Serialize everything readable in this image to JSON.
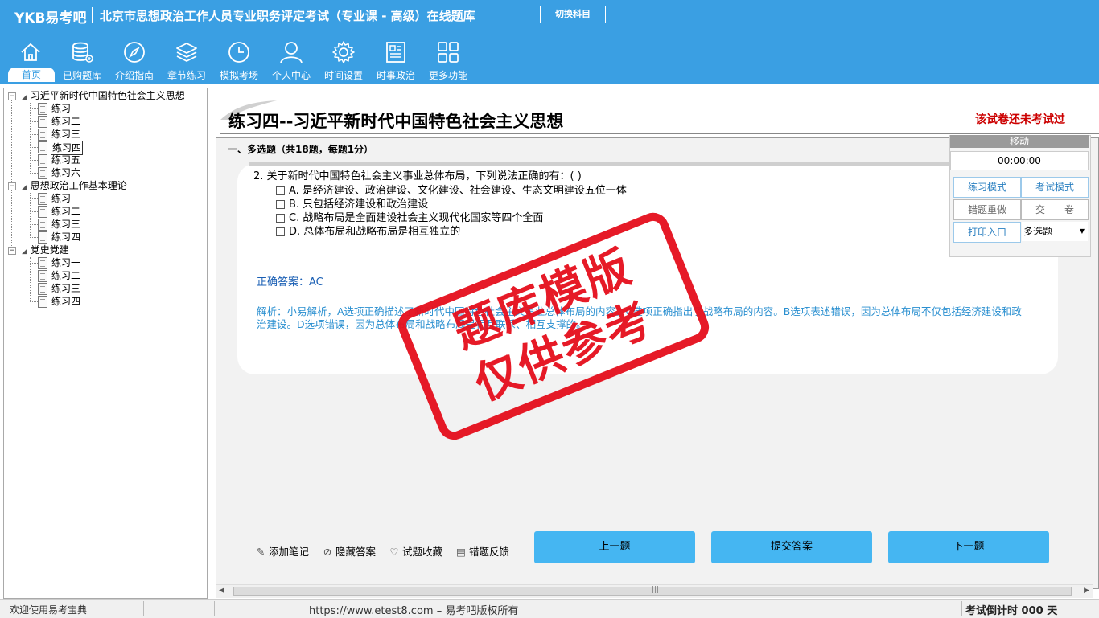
{
  "header": {
    "logo": "YKB易考吧",
    "title": "北京市思想政治工作人员专业职务评定考试（专业课 - 高级）在线题库",
    "switch_button": "切换科目"
  },
  "nav": [
    {
      "label": "首页",
      "icon": "home-icon"
    },
    {
      "label": "已购题库",
      "icon": "database-icon"
    },
    {
      "label": "介绍指南",
      "icon": "compass-icon"
    },
    {
      "label": "章节练习",
      "icon": "layers-icon"
    },
    {
      "label": "模拟考场",
      "icon": "clock-icon"
    },
    {
      "label": "个人中心",
      "icon": "user-icon"
    },
    {
      "label": "时间设置",
      "icon": "gear-icon"
    },
    {
      "label": "时事政治",
      "icon": "news-icon"
    },
    {
      "label": "更多功能",
      "icon": "grid-icon"
    }
  ],
  "tree": {
    "groups": [
      {
        "label": "习近平新时代中国特色社会主义思想",
        "items": [
          "练习一",
          "练习二",
          "练习三",
          "练习四",
          "练习五",
          "练习六"
        ]
      },
      {
        "label": "思想政治工作基本理论",
        "items": [
          "练习一",
          "练习二",
          "练习三",
          "练习四"
        ]
      },
      {
        "label": "党史党建",
        "items": [
          "练习一",
          "练习二",
          "练习三",
          "练习四"
        ]
      }
    ]
  },
  "exam": {
    "title": "练习四--习近平新时代中国特色社会主义思想",
    "status": "该试卷还未考试过",
    "section": "一、多选题（共18题，每题1分）",
    "question": "2. 关于新时代中国特色社会主义事业总体布局，下列说法正确的有：( )",
    "options": [
      "A. 是经济建设、政治建设、文化建设、社会建设、生态文明建设五位一体",
      "B. 只包括经济建设和政治建设",
      "C. 战略布局是全面建设社会主义现代化国家等四个全面",
      "D. 总体布局和战略布局是相互独立的"
    ],
    "answer_label": "正确答案：",
    "answer_value": "AC",
    "analysis": "解析：小易解析，A选项正确描述了新时代中国特色社会主义事业总体布局的内容。C选项正确指出了战略布局的内容。B选项表述错误，因为总体布局不仅包括经济建设和政治建设。D选项错误，因为总体布局和战略布局是相互联系、相互支撑的。"
  },
  "right_panel": {
    "move": "移动",
    "timer": "00:00:00",
    "practice_mode": "练习模式",
    "exam_mode": "考试模式",
    "redo_wrong": "错题重做",
    "submit_paper": "交　　卷",
    "print_entry": "打印入口",
    "question_type": "多选题"
  },
  "tools": {
    "add_note": "添加笔记",
    "hide_answer": "隐藏答案",
    "favorite": "试题收藏",
    "feedback": "错题反馈"
  },
  "buttons": {
    "prev": "上一题",
    "submit": "提交答案",
    "next": "下一题"
  },
  "statusbar": {
    "welcome": "欢迎使用易考宝典",
    "url": "https://www.etest8.com – 易考吧版权所有",
    "countdown": "考试倒计时 000 天"
  },
  "watermark": {
    "line1": "题库模版",
    "line2": "仅供参考"
  },
  "colors": {
    "header_bg": "#3a9fe3",
    "button_bg": "#45b6f2",
    "status_red": "#cc0000",
    "stamp_red": "#e50e1c"
  }
}
